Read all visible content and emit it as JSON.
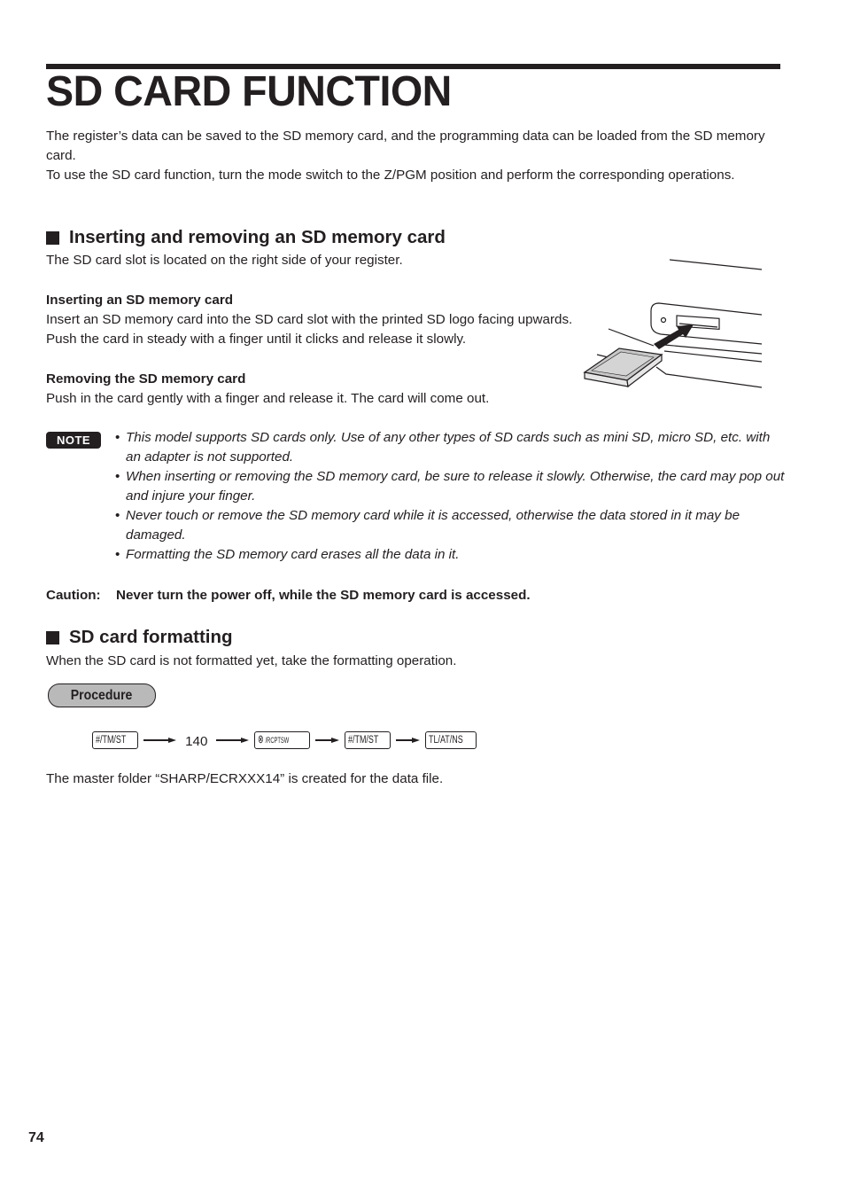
{
  "page": {
    "title": "SD CARD FUNCTION",
    "page_number": "74"
  },
  "intro": {
    "line1": "The register’s data can be saved to the SD memory card, and the programming data can be loaded from the SD memory card.",
    "line2": "To use the SD card function, turn the mode switch to the Z/PGM position and perform the corresponding operations."
  },
  "section_insert_remove": {
    "heading": "Inserting and removing an SD memory card",
    "slot_text": "The SD card slot is located on the right side of your register.",
    "inserting": {
      "heading": "Inserting an SD memory card",
      "text": "Insert an SD memory card into the SD card slot with the printed SD logo facing upwards. Push the card in steady with a finger until it clicks and release it slowly."
    },
    "removing": {
      "heading": "Removing the SD memory card",
      "text": "Push in the card gently with a finger and release it. The card will come out."
    },
    "illustration": "sd-card-insertion-illustration"
  },
  "note": {
    "badge": "NOTE",
    "items": [
      "This model supports SD cards only. Use of any other types of SD cards such as mini SD, micro SD, etc. with an adapter is not supported.",
      "When inserting or removing the SD memory card, be sure to release it slowly. Otherwise, the card may pop out and injure your finger.",
      "Never touch or remove the SD memory card while it is accessed, otherwise the data stored in it may be damaged.",
      "Formatting the SD memory card erases all the data in it."
    ]
  },
  "caution": {
    "label": "Caution:",
    "text": "Never turn the power off, while the SD memory card is accessed."
  },
  "section_formatting": {
    "heading": "SD card formatting",
    "text": "When the SD card is not formatted yet, take the formatting operation.",
    "procedure_label": "Procedure",
    "sequence": {
      "key1": "#/TM/ST",
      "number": "140",
      "key2_symbol": "⊗",
      "key2_text": "/RCPTSW",
      "key3": "#/TM/ST",
      "key4": "TL/AT/NS"
    },
    "result_text": "The master folder “SHARP/ECRXXX14” is created for the data file."
  }
}
